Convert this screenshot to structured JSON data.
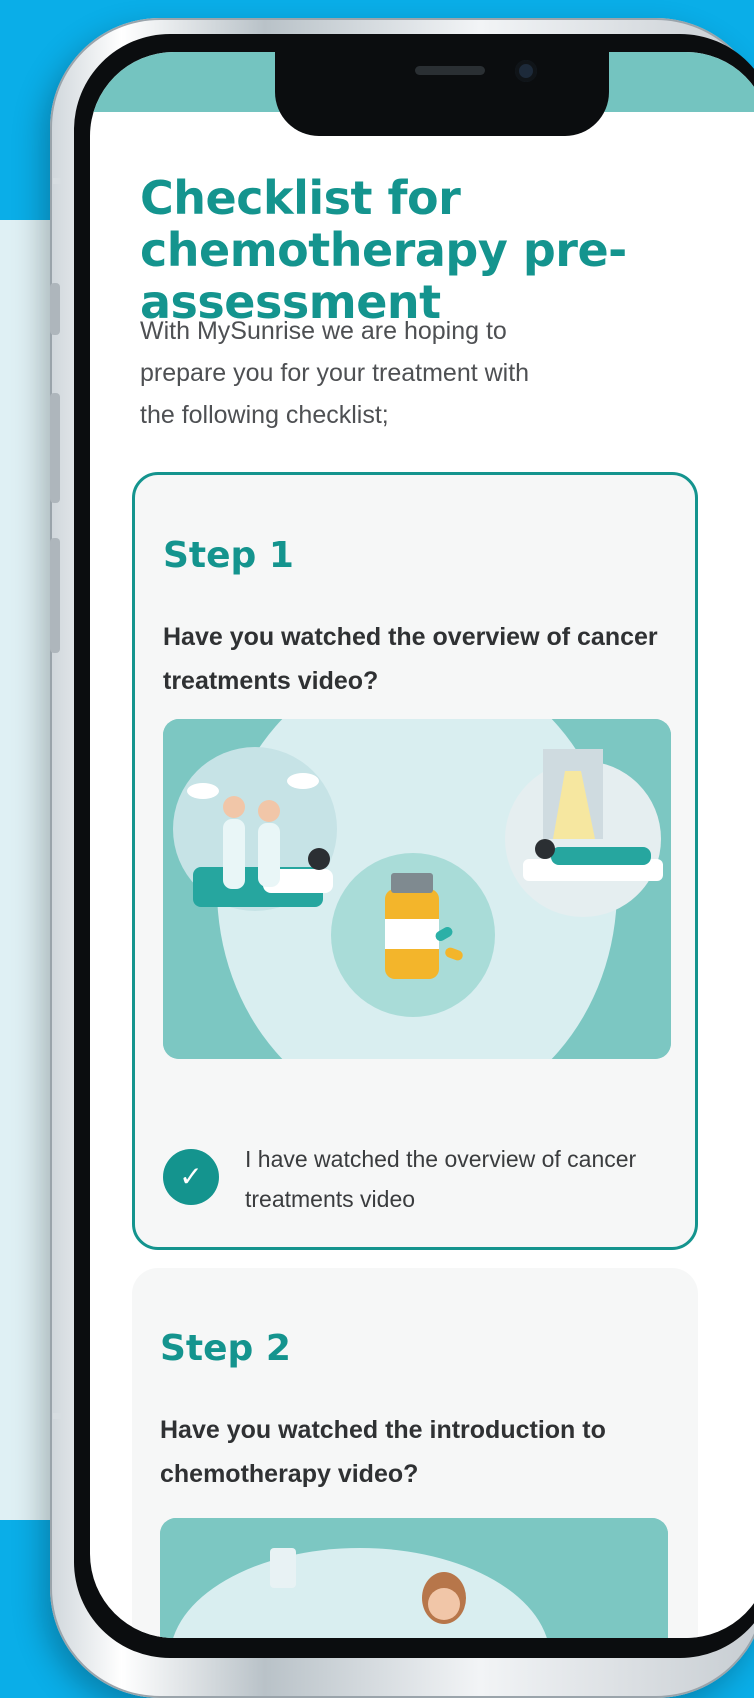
{
  "colors": {
    "background": "#0aaee8",
    "teal": "#14948e",
    "illustration": "#7cc7c2"
  },
  "page": {
    "title": "Checklist for chemotherapy pre-assessment",
    "intro": "With MySunrise we are hoping to prepare you for your treatment with the following checklist;"
  },
  "steps": [
    {
      "title": "Step 1",
      "question": "Have you watched the overview of cancer treatments video?",
      "illustration_icon": "cancer-treatments-illustration",
      "checkbox_label": "I have watched the overview of cancer treatments video",
      "checked": true
    },
    {
      "title": "Step 2",
      "question": "Have you watched the introduction to chemotherapy video?",
      "illustration_icon": "chemotherapy-illustration"
    }
  ],
  "icons": {
    "check": "✓"
  }
}
